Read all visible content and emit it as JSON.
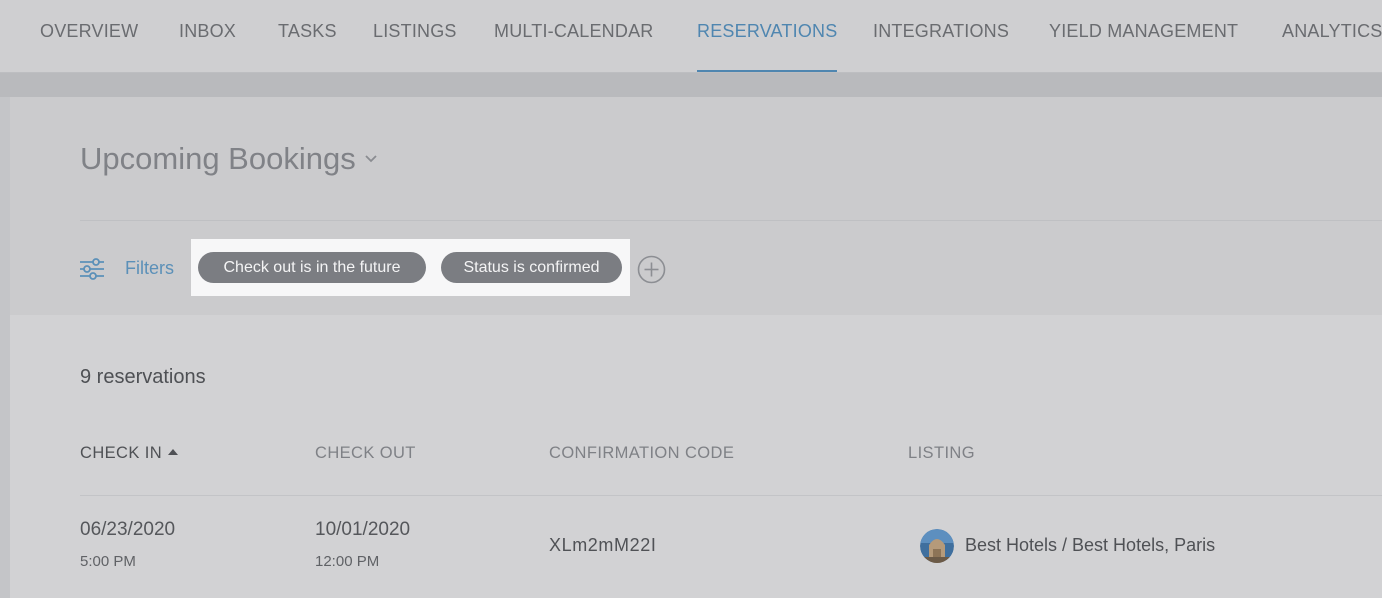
{
  "nav": {
    "tabs": [
      {
        "label": "OVERVIEW"
      },
      {
        "label": "INBOX"
      },
      {
        "label": "TASKS"
      },
      {
        "label": "LISTINGS"
      },
      {
        "label": "MULTI-CALENDAR"
      },
      {
        "label": "RESERVATIONS",
        "active": true
      },
      {
        "label": "INTEGRATIONS"
      },
      {
        "label": "YIELD MANAGEMENT"
      },
      {
        "label": "ANALYTICS"
      }
    ]
  },
  "view": {
    "title": "Upcoming Bookings",
    "filters_label": "Filters",
    "chips": [
      {
        "label": "Check out is in the future"
      },
      {
        "label": "Status is confirmed"
      }
    ]
  },
  "results": {
    "count_text": "9 reservations",
    "columns": {
      "check_in": "CHECK IN",
      "check_out": "CHECK OUT",
      "confirmation_code": "CONFIRMATION CODE",
      "listing": "LISTING"
    },
    "rows": [
      {
        "check_in_date": "06/23/2020",
        "check_in_time": "5:00 PM",
        "check_out_date": "10/01/2020",
        "check_out_time": "12:00 PM",
        "confirmation_code": "XLm2mM22I",
        "listing": "Best Hotels / Best Hotels, Paris"
      }
    ]
  },
  "colors": {
    "accent": "#4f86b0",
    "chip_bg": "#7b7d82",
    "highlight": "#f7f7f8"
  },
  "icons": {
    "title_dropdown": "chevron-down-icon",
    "filters": "sliders-icon",
    "add_filter": "plus-circle-icon",
    "sort": "sort-ascending-icon"
  }
}
